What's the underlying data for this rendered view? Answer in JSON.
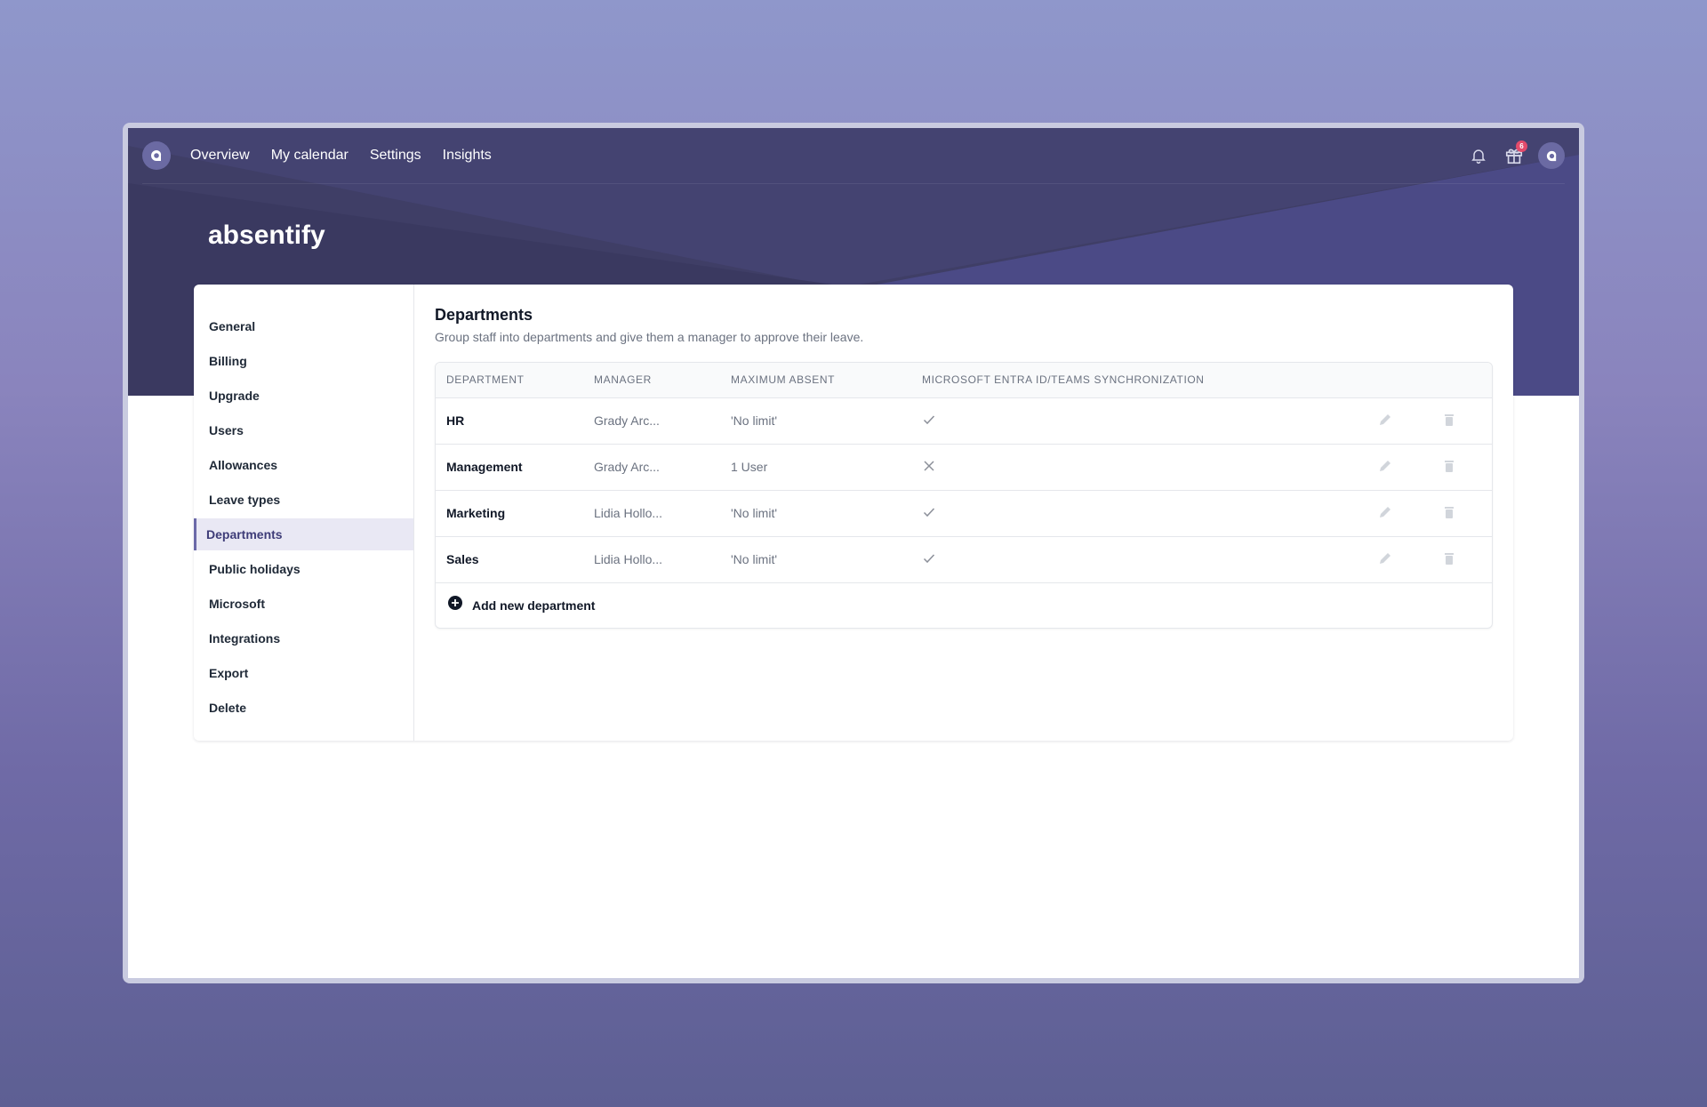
{
  "nav": {
    "items": [
      "Overview",
      "My calendar",
      "Settings",
      "Insights"
    ],
    "gift_badge_count": "6",
    "icons": [
      "absentify-logo-icon",
      "bell-icon",
      "gift-icon",
      "avatar"
    ]
  },
  "brand": {
    "title": "absentify"
  },
  "sidebar": {
    "items": [
      {
        "label": "General"
      },
      {
        "label": "Billing"
      },
      {
        "label": "Upgrade"
      },
      {
        "label": "Users"
      },
      {
        "label": "Allowances"
      },
      {
        "label": "Leave types"
      },
      {
        "label": "Departments",
        "active": true
      },
      {
        "label": "Public holidays"
      },
      {
        "label": "Microsoft"
      },
      {
        "label": "Integrations"
      },
      {
        "label": "Export"
      },
      {
        "label": "Delete"
      }
    ]
  },
  "departments": {
    "title": "Departments",
    "description": "Group staff into departments and give them a manager to approve their leave.",
    "columns": [
      "DEPARTMENT",
      "MANAGER",
      "MAXIMUM ABSENT",
      "MICROSOFT ENTRA ID/TEAMS SYNCHRONIZATION"
    ],
    "rows": [
      {
        "department": "HR",
        "manager": "Grady Arc...",
        "max_absent": "'No limit'",
        "sync": "check-icon"
      },
      {
        "department": "Management",
        "manager": "Grady Arc...",
        "max_absent": "1 User",
        "sync": "x-icon"
      },
      {
        "department": "Marketing",
        "manager": "Lidia Hollo...",
        "max_absent": "'No limit'",
        "sync": "check-icon"
      },
      {
        "department": "Sales",
        "manager": "Lidia Hollo...",
        "max_absent": "'No limit'",
        "sync": "check-icon"
      }
    ],
    "add_label": "Add new department"
  },
  "colors": {
    "hero_bg": "#3f3e66",
    "accent": "#6b69a8",
    "badge": "#e34b6b",
    "page_bg_top": "#8f97cb",
    "page_bg_bottom": "#5d5f93"
  }
}
